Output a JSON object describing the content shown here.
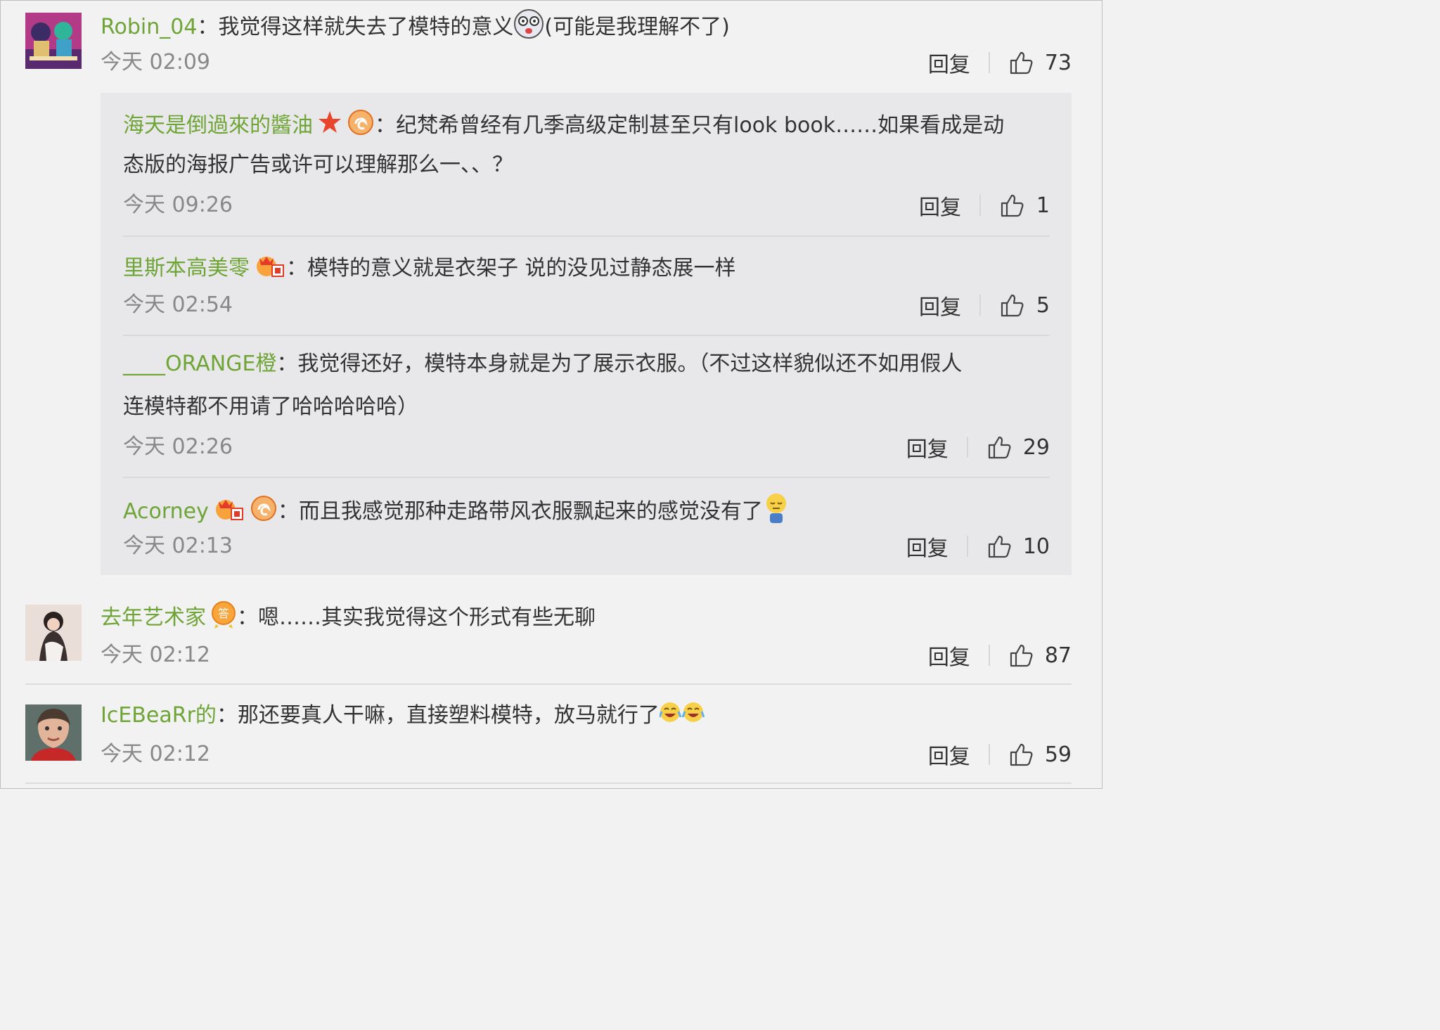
{
  "comments": [
    {
      "user": "Robin_04",
      "text_a": "我觉得这样就失去了模特的意义",
      "text_b": "(可能是我理解不了)",
      "time": "今天 02:09",
      "reply": "回复",
      "likes": "73",
      "emoji_icon": "dizzy-face-icon"
    },
    {
      "user": "去年艺术家",
      "text_a": "嗯……其实我觉得这个形式有些无聊",
      "time": "今天 02:12",
      "reply": "回复",
      "likes": "87",
      "badge_icon": "answer-badge-icon"
    },
    {
      "user": "IcEBeaRr的",
      "text_a": "那还要真人干嘛，直接塑料模特，放马就行了",
      "time": "今天 02:12",
      "reply": "回复",
      "likes": "59",
      "emoji_icon": "laugh-cry-icon"
    }
  ],
  "replies": [
    {
      "user": "海天是倒過來的醬油",
      "line1": "纪梵希曾经有几季高级定制甚至只有look book……如果看成是动",
      "line2": "态版的海报广告或许可以理解那么一、、？",
      "time": "今天 09:26",
      "reply": "回复",
      "likes": "1"
    },
    {
      "user": "里斯本高美零",
      "line1": "模特的意义就是衣架子 说的没见过静态展一样",
      "time": "今天 02:54",
      "reply": "回复",
      "likes": "5"
    },
    {
      "user": "____ORANGE橙",
      "line1": "我觉得还好，模特本身就是为了展示衣服。（不过这样貌似还不如用假人",
      "line2": "连模特都不用请了哈哈哈哈哈）",
      "time": "今天 02:26",
      "reply": "回复",
      "likes": "29"
    },
    {
      "user": "Acorney",
      "line1": "而且我感觉那种走路带风衣服飘起来的感觉没有了",
      "time": "今天 02:13",
      "reply": "回复",
      "likes": "10"
    }
  ],
  "colors": {
    "username": "#6fa436",
    "time": "#888888",
    "reply_bg": "#e8e8ea",
    "page_bg": "#f2f2f2"
  }
}
